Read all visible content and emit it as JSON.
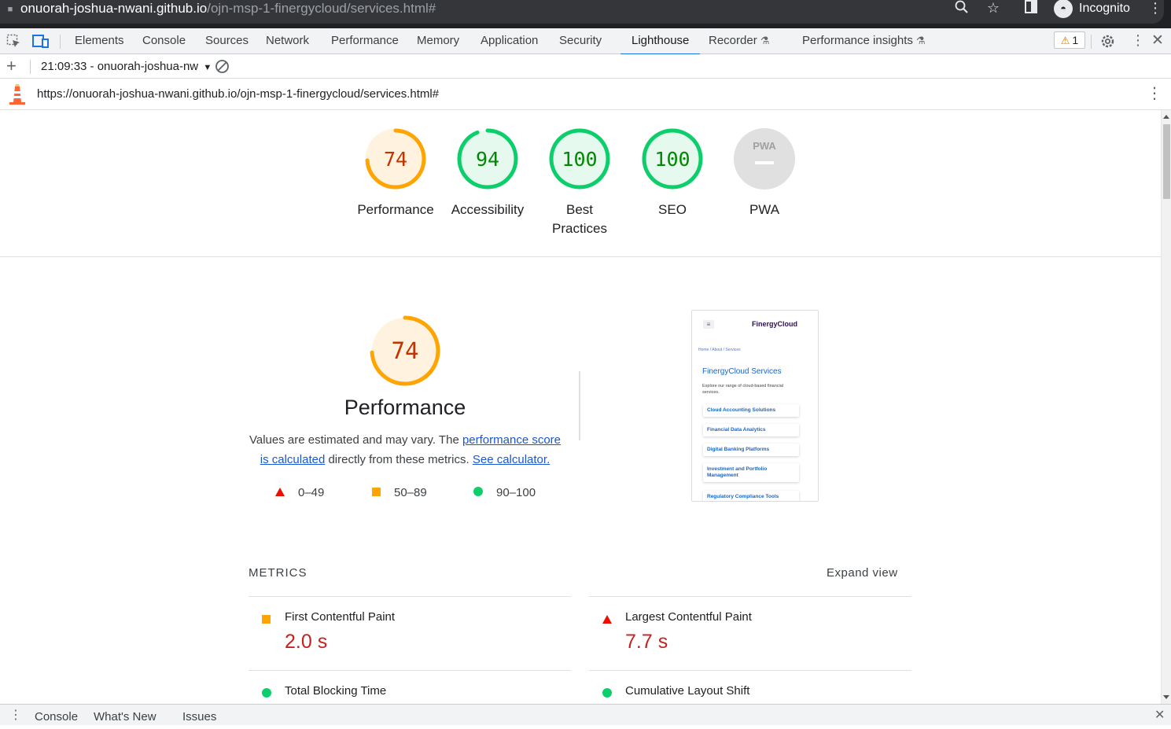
{
  "browser": {
    "url_host": "onuorah-joshua-nwani.github.io",
    "url_path": "/ojn-msp-1-finergycloud/services.html#",
    "profile_label": "Incognito"
  },
  "devtools": {
    "tabs": [
      "Elements",
      "Console",
      "Sources",
      "Network",
      "Performance",
      "Memory",
      "Application",
      "Security",
      "Lighthouse",
      "Recorder",
      "Performance insights"
    ],
    "active_tab": "Lighthouse",
    "warning_count": "1"
  },
  "lighthouse_toolbar": {
    "report_label": "21:09:33 - onuorah-joshua-nw"
  },
  "report": {
    "url": "https://onuorah-joshua-nwani.github.io/ojn-msp-1-finergycloud/services.html#"
  },
  "scores": [
    {
      "value": 74,
      "label": "Performance",
      "rating": "average"
    },
    {
      "value": 94,
      "label": "Accessibility",
      "rating": "pass"
    },
    {
      "value": 100,
      "label": "Best Practices",
      "label_line1": "Best",
      "label_line2": "Practices",
      "rating": "pass"
    },
    {
      "value": 100,
      "label": "SEO",
      "rating": "pass"
    },
    {
      "value": null,
      "label": "PWA",
      "badge": "PWA",
      "rating": "na"
    }
  ],
  "performance": {
    "score": 74,
    "title": "Performance",
    "desc_prefix": "Values are estimated and may vary. The ",
    "desc_link1": "performance score is calculated",
    "desc_middle": " directly from these metrics. ",
    "desc_link2": "See calculator.",
    "legend": [
      {
        "range": "0–49",
        "shape": "triangle",
        "color": "#eb0f00"
      },
      {
        "range": "50–89",
        "shape": "square",
        "color": "#ffa400"
      },
      {
        "range": "90–100",
        "shape": "circle",
        "color": "#0cce6b"
      }
    ]
  },
  "screenshot": {
    "brand": "FinergyCloud",
    "breadcrumb": "Home  /  About  /  Services",
    "title": "FinergyCloud Services",
    "subtitle": "Explore our range of cloud-based financial services.",
    "cards": [
      "Cloud Accounting Solutions",
      "Financial Data Analytics",
      "Digital Banking Platforms",
      "Investment and Portfolio Management",
      "Regulatory Compliance Tools"
    ]
  },
  "metrics": {
    "heading": "METRICS",
    "expand_label": "Expand view",
    "items": [
      {
        "name": "First Contentful Paint",
        "value": "2.0 s",
        "rating": "average"
      },
      {
        "name": "Largest Contentful Paint",
        "value": "7.7 s",
        "rating": "fail"
      },
      {
        "name": "Total Blocking Time",
        "value": "",
        "rating": "pass"
      },
      {
        "name": "Cumulative Layout Shift",
        "value": "",
        "rating": "pass"
      }
    ]
  },
  "drawer": {
    "tabs": [
      "Console",
      "What's New",
      "Issues"
    ]
  },
  "colors": {
    "pass": "#0cce6b",
    "pass_text": "#008800",
    "average": "#ffa400",
    "average_text": "#c33300",
    "fail": "#eb0f00",
    "accent": "#1a73e8"
  }
}
